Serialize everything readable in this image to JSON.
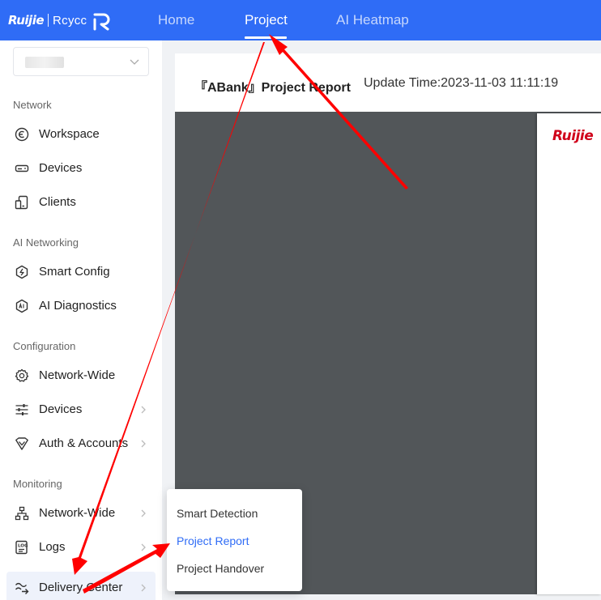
{
  "topbar": {
    "logo": {
      "brand": "Ruijie",
      "product": "Rcycc"
    },
    "nav": [
      {
        "label": "Home"
      },
      {
        "label": "Project",
        "active": true
      },
      {
        "label": "AI Heatmap"
      }
    ]
  },
  "sidebar": {
    "groups": [
      {
        "title": "Network",
        "items": [
          {
            "label": "Workspace",
            "icon": "workspace-icon"
          },
          {
            "label": "Devices",
            "icon": "device-icon"
          },
          {
            "label": "Clients",
            "icon": "clients-icon"
          }
        ]
      },
      {
        "title": "AI Networking",
        "items": [
          {
            "label": "Smart Config",
            "icon": "smart-config-icon"
          },
          {
            "label": "AI Diagnostics",
            "icon": "ai-diagnostics-icon"
          }
        ]
      },
      {
        "title": "Configuration",
        "items": [
          {
            "label": "Network-Wide",
            "icon": "gear-icon"
          },
          {
            "label": "Devices",
            "icon": "sliders-icon",
            "has_submenu": true
          },
          {
            "label": "Auth & Accounts",
            "icon": "shield-icon",
            "has_submenu": true
          }
        ]
      },
      {
        "title": "Monitoring",
        "items": [
          {
            "label": "Network-Wide",
            "icon": "topology-icon",
            "has_submenu": true
          },
          {
            "label": "Logs",
            "icon": "logs-icon",
            "has_submenu": true
          },
          {
            "label": "Delivery Center",
            "icon": "delivery-icon",
            "has_submenu": true,
            "selected": true
          }
        ]
      }
    ]
  },
  "report": {
    "title": "『ABank』Project Report",
    "update_time": "Update Time:2023-11-03 11:11:19",
    "page_logo": "Ruijie"
  },
  "submenu": {
    "items": [
      {
        "label": "Smart Detection"
      },
      {
        "label": "Project Report",
        "active": true
      },
      {
        "label": "Project Handover"
      }
    ]
  },
  "colors": {
    "primary": "#2f6cf6",
    "annotation_arrow": "#ff0000",
    "preview_bg": "#525659",
    "brand_red": "#d0021b"
  }
}
